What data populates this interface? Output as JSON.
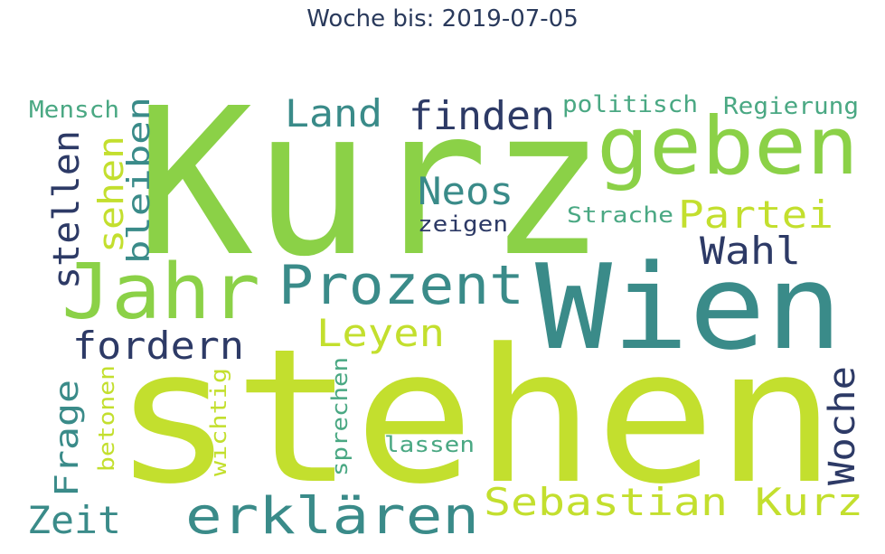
{
  "title": "Woche bis: 2019-07-05",
  "colors": {
    "navy": "#2d3a66",
    "teal": "#3a8b89",
    "green": "#8bd147",
    "lime": "#c3df2e",
    "tealgreen": "#4aa883"
  },
  "words": [
    {
      "text": "Kurz",
      "color": "green"
    },
    {
      "text": "stehen",
      "color": "lime"
    },
    {
      "text": "Wien",
      "color": "teal"
    },
    {
      "text": "geben",
      "color": "green"
    },
    {
      "text": "Jahr",
      "color": "green"
    },
    {
      "text": "Prozent",
      "color": "teal"
    },
    {
      "text": "erklären",
      "color": "teal"
    },
    {
      "text": "Sebastian Kurz",
      "color": "lime"
    },
    {
      "text": "finden",
      "color": "navy"
    },
    {
      "text": "Land",
      "color": "teal"
    },
    {
      "text": "Neos",
      "color": "teal"
    },
    {
      "text": "Partei",
      "color": "lime"
    },
    {
      "text": "Wahl",
      "color": "navy"
    },
    {
      "text": "Leyen",
      "color": "lime"
    },
    {
      "text": "fordern",
      "color": "navy"
    },
    {
      "text": "Zeit",
      "color": "teal"
    },
    {
      "text": "Woche",
      "color": "navy"
    },
    {
      "text": "stellen",
      "color": "navy"
    },
    {
      "text": "sehen",
      "color": "lime"
    },
    {
      "text": "bleiben",
      "color": "teal"
    },
    {
      "text": "Frage",
      "color": "teal"
    },
    {
      "text": "Mensch",
      "color": "tealgreen"
    },
    {
      "text": "politisch",
      "color": "tealgreen"
    },
    {
      "text": "Regierung",
      "color": "tealgreen"
    },
    {
      "text": "Strache",
      "color": "tealgreen"
    },
    {
      "text": "zeigen",
      "color": "navy"
    },
    {
      "text": "lassen",
      "color": "tealgreen"
    },
    {
      "text": "sprechen",
      "color": "tealgreen"
    },
    {
      "text": "wichtig",
      "color": "lime"
    },
    {
      "text": "betonen",
      "color": "lime"
    }
  ]
}
